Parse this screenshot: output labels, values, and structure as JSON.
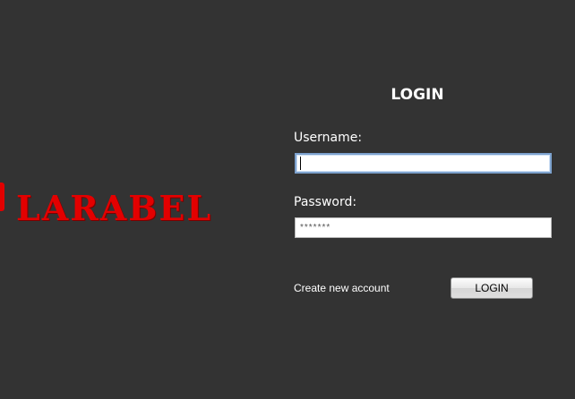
{
  "brand": {
    "logo_text": "LARABEL",
    "logo_color": "#e30000"
  },
  "login_form": {
    "title": "LOGIN",
    "username_label": "Username:",
    "username_value": "",
    "password_label": "Password:",
    "password_value": "*******",
    "create_account_label": "Create new account",
    "login_button_label": "LOGIN"
  },
  "colors": {
    "background": "#333333",
    "focus_border": "#7da2ce"
  }
}
